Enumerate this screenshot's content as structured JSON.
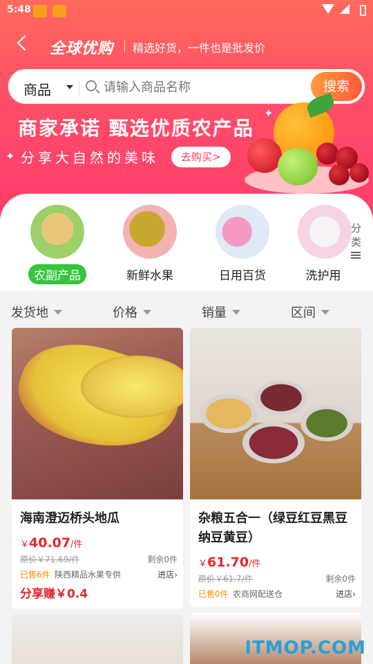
{
  "status_bar": {
    "time": "5:48"
  },
  "nav": {
    "title": "全球优购",
    "subtitle": "精选好货，一件也是批发价"
  },
  "search": {
    "category": "商品",
    "placeholder": "请输入商品名称",
    "button": "搜索"
  },
  "banner": {
    "headline": "商家承诺 甄选优质农产品",
    "tagline": "分享大自然的美味",
    "cta": "去购买>"
  },
  "categories": [
    {
      "label": "农副产品",
      "active": true
    },
    {
      "label": "新鲜水果",
      "active": false
    },
    {
      "label": "日用百货",
      "active": false
    },
    {
      "label": "洗护用",
      "active": false
    }
  ],
  "categories_more": "分类",
  "filters": [
    "发货地",
    "价格",
    "销量",
    "区间"
  ],
  "products": [
    {
      "name": "海南澄迈桥头地瓜",
      "price_symbol": "￥",
      "price": "40.07",
      "unit": "/件",
      "original": "原价￥71.69/件",
      "remaining": "剩余0件",
      "sold": "已售6件",
      "shop": "陕西精品水果专供",
      "enter": "进店",
      "share": "分享赚￥0.4"
    },
    {
      "name": "杂粮五合一（绿豆红豆黑豆纳豆黄豆）",
      "price_symbol": "￥",
      "price": "61.70",
      "unit": "/件",
      "original": "原价￥61.7/件",
      "remaining": "剩余0件",
      "sold": "已售0件",
      "shop": "农商网配送仓",
      "enter": "进店"
    }
  ],
  "watermark": "ITMOP.COM",
  "colors": {
    "brand_red": "#ff4e68",
    "price_red": "#e8262d",
    "active_green": "#35c53d",
    "search_orange": "#ff7a3a"
  }
}
